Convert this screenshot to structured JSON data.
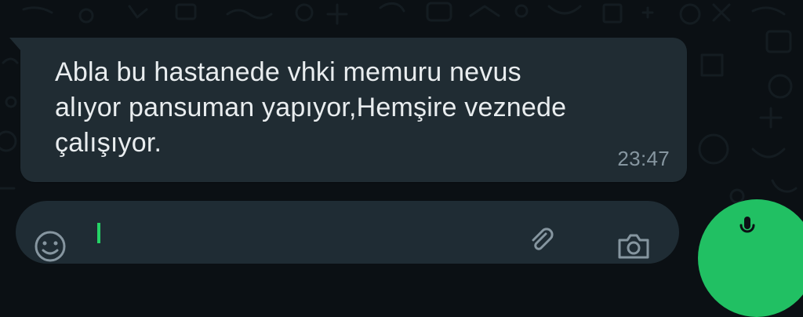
{
  "chat": {
    "message": {
      "text": "Abla bu hastanede vhki memuru nevus\nalıyor pansuman yapıyor,Hemşire veznede\nçalışıyor.",
      "time": "23:47"
    }
  },
  "composer": {
    "emoji_icon": "emoji-icon",
    "attach_icon": "paperclip-icon",
    "camera_icon": "camera-icon",
    "mic_icon": "microphone-icon"
  },
  "colors": {
    "background": "#0b1014",
    "bubble": "#202c33",
    "text": "#e9edef",
    "time": "#8696a0",
    "accent": "#21c063"
  }
}
